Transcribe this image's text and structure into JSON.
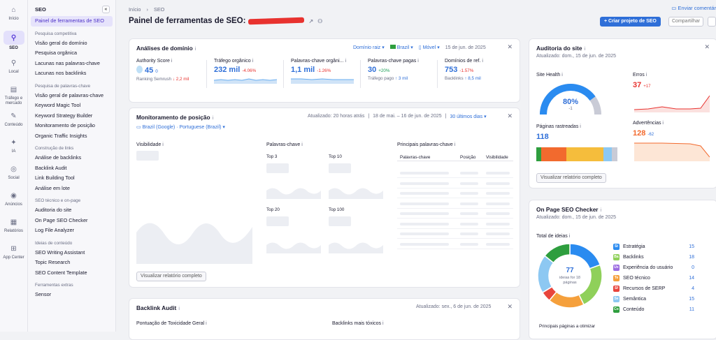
{
  "rail": [
    {
      "label": "Início",
      "icon": "home-icon",
      "glyph": "⌂",
      "active": false
    },
    {
      "label": "SEO",
      "icon": "seo-icon",
      "glyph": "⚲",
      "active": true
    },
    {
      "label": "Local",
      "icon": "location-pin-icon",
      "glyph": "⚲",
      "active": false
    },
    {
      "label": "Tráfego e mercado",
      "icon": "traffic-icon",
      "glyph": "▤",
      "active": false
    },
    {
      "label": "Conteúdo",
      "icon": "content-icon",
      "glyph": "✎",
      "active": false
    },
    {
      "label": "IA",
      "icon": "ai-icon",
      "glyph": "✦",
      "active": false
    },
    {
      "label": "Social",
      "icon": "social-icon",
      "glyph": "◎",
      "active": false
    },
    {
      "label": "Anúncios",
      "icon": "ads-icon",
      "glyph": "◉",
      "active": false
    },
    {
      "label": "Relatórios",
      "icon": "reports-icon",
      "glyph": "▦",
      "active": false
    },
    {
      "label": "App Center",
      "icon": "app-center-icon",
      "glyph": "⊞",
      "active": false
    }
  ],
  "sidebar": {
    "title": "SEO",
    "items": [
      {
        "type": "item",
        "label": "Painel de ferramentas de SEO",
        "active": true
      },
      {
        "type": "section",
        "label": "Pesquisa competitiva"
      },
      {
        "type": "item",
        "label": "Visão geral do domínio"
      },
      {
        "type": "item",
        "label": "Pesquisa orgânica"
      },
      {
        "type": "item",
        "label": "Lacunas nas palavras-chave"
      },
      {
        "type": "item",
        "label": "Lacunas nos backlinks"
      },
      {
        "type": "section",
        "label": "Pesquisa de palavras-chave"
      },
      {
        "type": "item",
        "label": "Visão geral de palavras-chave"
      },
      {
        "type": "item",
        "label": "Keyword Magic Tool"
      },
      {
        "type": "item",
        "label": "Keyword Strategy Builder"
      },
      {
        "type": "item",
        "label": "Monitoramento de posição"
      },
      {
        "type": "item",
        "label": "Organic Traffic Insights"
      },
      {
        "type": "section",
        "label": "Construção de links"
      },
      {
        "type": "item",
        "label": "Análise de backlinks"
      },
      {
        "type": "item",
        "label": "Backlink Audit"
      },
      {
        "type": "item",
        "label": "Link Building Tool"
      },
      {
        "type": "item",
        "label": "Análise em lote"
      },
      {
        "type": "section",
        "label": "SEO técnico e on-page"
      },
      {
        "type": "item",
        "label": "Auditoria do site"
      },
      {
        "type": "item",
        "label": "On Page SEO Checker"
      },
      {
        "type": "item",
        "label": "Log File Analyzer"
      },
      {
        "type": "section",
        "label": "Ideias de conteúdo"
      },
      {
        "type": "item",
        "label": "SEO Writing Assistant"
      },
      {
        "type": "item",
        "label": "Topic Research"
      },
      {
        "type": "item",
        "label": "SEO Content Template"
      },
      {
        "type": "section",
        "label": "Ferramentas extras"
      },
      {
        "type": "item",
        "label": "Sensor"
      }
    ]
  },
  "header": {
    "crumb_home": "Início",
    "crumb_current": "SEO",
    "title": "Painel de ferramentas de SEO:",
    "feedback": "Enviar comentár",
    "create_project": "+ Criar projeto de SEO",
    "share": "Compartilhar"
  },
  "domain_analysis": {
    "title": "Análises de domínio",
    "filter_root": "Domínio raiz",
    "filter_country": "Brazil",
    "filter_device": "Móvel",
    "date": "15 de jun. de 2025",
    "kpis": [
      {
        "label": "Authority Score",
        "value": "45",
        "delta": "0",
        "sub": "Ranking Semrush",
        "sub_value": "↓ 2,2 mil"
      },
      {
        "label": "Tráfego orgânico",
        "value": "232 mil",
        "delta": "-4.06%",
        "sub": "",
        "sub_value": ""
      },
      {
        "label": "Palavras-chave orgâni...",
        "value": "1,1 mil",
        "delta": "-1.26%",
        "sub": "",
        "sub_value": ""
      },
      {
        "label": "Palavras-chave pagas",
        "value": "30",
        "delta": "+20%",
        "sub": "Tráfego pago",
        "sub_value": "↑ 3 mil"
      },
      {
        "label": "Domínios de ref.",
        "value": "753",
        "delta": "-1.57%",
        "sub": "Backlinks",
        "sub_value": "↑ 8,5 mil"
      }
    ]
  },
  "position_tracking": {
    "title": "Monitoramento de posição",
    "updated": "Atualizado: 20 horas atrás",
    "range": "18 de mai. – 16 de jun. de 2025",
    "period": "30 últimos dias",
    "location": "Brazil (Google) · Portuguese (Brazil)",
    "visibility_label": "Visibilidade",
    "keywords_label": "Palavras-chave",
    "top3": "Top 3",
    "top10": "Top 10",
    "top20": "Top 20",
    "top100": "Top 100",
    "main_keywords_label": "Principais palavras-chave",
    "col_keywords": "Palavras-chave",
    "col_position": "Posição",
    "col_visibility": "Visibilidade",
    "view_report": "Visualizar relatório completo"
  },
  "backlink_audit": {
    "title": "Backlink Audit",
    "updated": "Atualizado: sex., 6 de jun. de 2025",
    "toxic_score": "Pontuação de Toxicidade Geral",
    "most_toxic": "Backlinks mais tóxicos"
  },
  "site_audit": {
    "title": "Auditoria do site",
    "updated": "Atualizado: dom., 15 de jun. de 2025",
    "health_label": "Site Health",
    "health_value": "80%",
    "health_delta": "-1",
    "health_fraction": 0.8,
    "errors_label": "Erros",
    "errors_value": "37",
    "errors_delta": "+17",
    "crawled_label": "Páginas rastreadas",
    "crawled_value": "118",
    "warnings_label": "Advertências",
    "warnings_value": "128",
    "warnings_delta": "-62",
    "view_report": "Visualizar relatório completo"
  },
  "onpage": {
    "title": "On Page SEO Checker",
    "updated": "Atualizado: dom., 15 de jun. de 2025",
    "total_label": "Total de ideias",
    "center_value": "77",
    "center_sub": "ideias for 18 páginas",
    "top_pages": "Principais páginas a otimizar",
    "legend": [
      {
        "abbr": "St",
        "label": "Estratégia",
        "count": "15",
        "value": 15,
        "color": "#2a8bf0"
      },
      {
        "abbr": "Ba",
        "label": "Backlinks",
        "count": "18",
        "value": 18,
        "color": "#8fd05a"
      },
      {
        "abbr": "Ux",
        "label": "Experiência do usuário",
        "count": "0",
        "value": 0,
        "color": "#9b6be0"
      },
      {
        "abbr": "Te",
        "label": "SEO técnico",
        "count": "14",
        "value": 14,
        "color": "#f5a03c"
      },
      {
        "abbr": "Sf",
        "label": "Recursos de SERP",
        "count": "4",
        "value": 4,
        "color": "#e8453c"
      },
      {
        "abbr": "Se",
        "label": "Semântica",
        "count": "15",
        "value": 15,
        "color": "#8dc8f2"
      },
      {
        "abbr": "Co",
        "label": "Conteúdo",
        "count": "11",
        "value": 11,
        "color": "#2e9e3e"
      }
    ]
  }
}
